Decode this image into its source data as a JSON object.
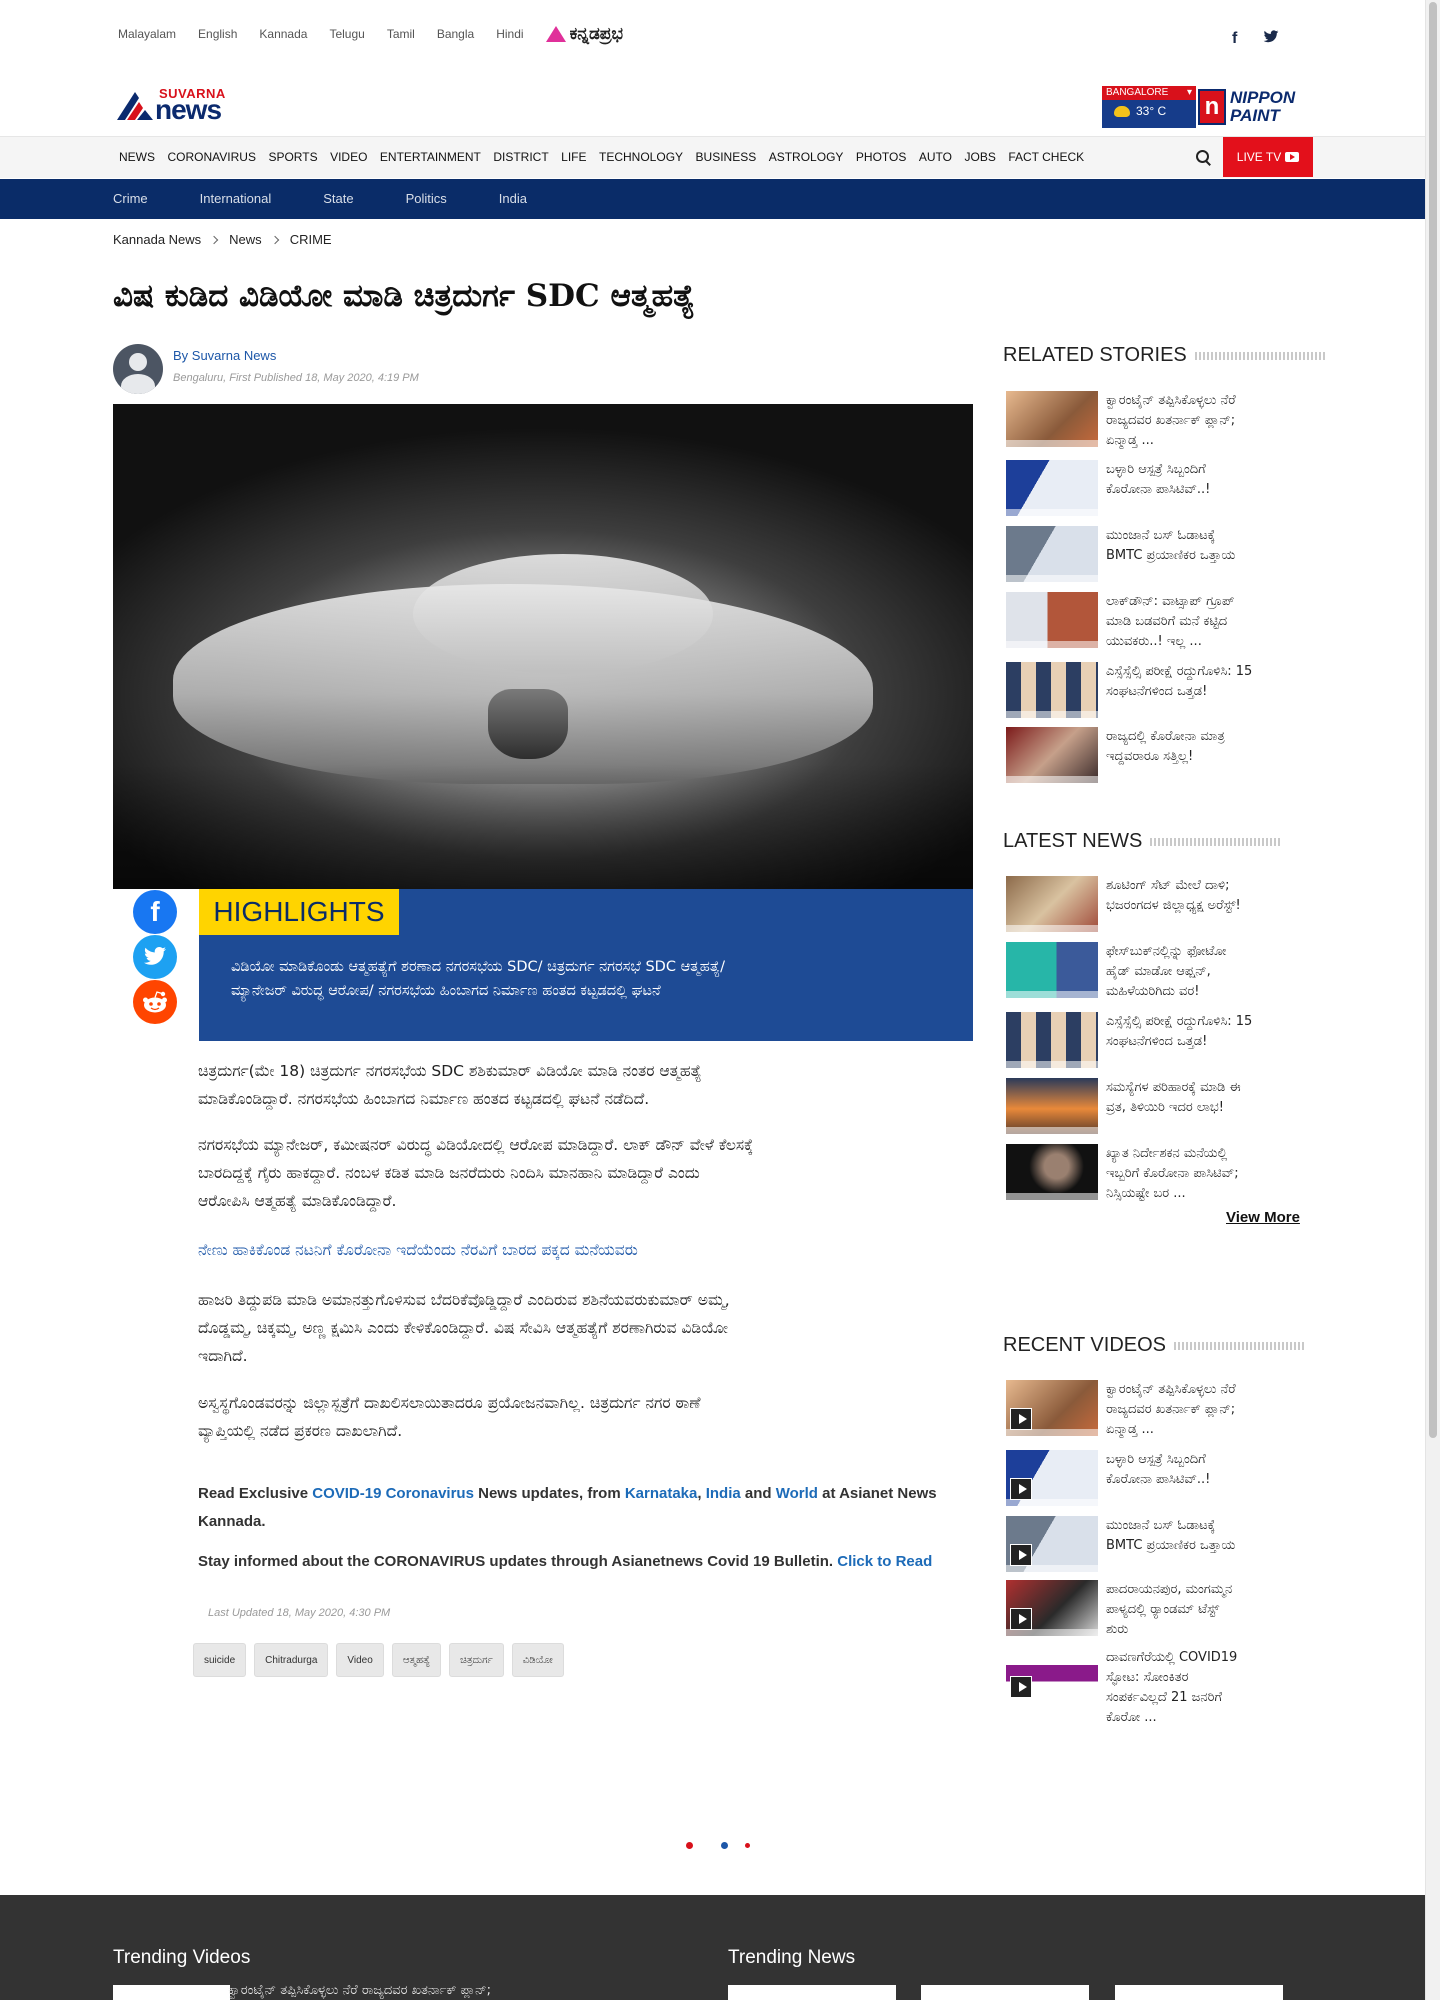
{
  "languages": [
    "Malayalam",
    "English",
    "Kannada",
    "Telugu",
    "Tamil",
    "Bangla",
    "Hindi"
  ],
  "kannadaprabha_logo": "ಕನ್ನಡಪ್ರಭ",
  "social_top": {
    "facebook": "f",
    "twitter": "t"
  },
  "logo": {
    "suvarna": "SUVARNA",
    "news": "news"
  },
  "weather": {
    "city": "BANGALORE",
    "temp": "33° C"
  },
  "sponsor": {
    "mark": "n",
    "line1": "NIPPON",
    "line2": "PAINT"
  },
  "main_nav": [
    "NEWS",
    "CORONAVIRUS",
    "SPORTS",
    "VIDEO",
    "ENTERTAINMENT",
    "DISTRICT",
    "LIFE",
    "TECHNOLOGY",
    "BUSINESS",
    "ASTROLOGY",
    "PHOTOS",
    "AUTO",
    "JOBS",
    "FACT CHECK"
  ],
  "live_tv": "LIVE TV",
  "sub_nav": [
    "Crime",
    "International",
    "State",
    "Politics",
    "India"
  ],
  "breadcrumb": [
    "Kannada News",
    "News",
    "CRIME"
  ],
  "article": {
    "title": "ವಿಷ ಕುಡಿದ ವಿಡಿಯೋ ಮಾಡಿ ಚಿತ್ರದುರ್ಗ SDC ಆತ್ಮಹತ್ಯೆ",
    "author": "By Suvarna News",
    "meta": "Bengaluru, First Published 18, May 2020, 4:19 PM",
    "highlights_label": "HIGHLIGHTS",
    "highlights_line1": "ವಿಡಿಯೋ ಮಾಡಿಕೊಂಡು ಆತ್ಮಹತ್ಯೆಗೆ ಶರಣಾದ ನಗರಸಭೆಯ SDC/ ಚಿತ್ರದುರ್ಗ ನಗರಸಭೆ SDC ಆತ್ಮಹತ್ಯೆ/",
    "highlights_line2": "ಮ್ಯಾನೇಜರ್ ವಿರುದ್ಧ ಆರೋಪ/  ನಗರಸಭೆಯ ಹಿಂಬಾಗದ ನಿರ್ಮಾಣ ಹಂತದ ಕಟ್ಟಡದಲ್ಲಿ ಘಟನೆ",
    "p1_l1": "ಚಿತ್ರದುರ್ಗ(ಮೇ 18)  ಚಿತ್ರದುರ್ಗ ನಗರಸಭೆಯ SDC ಶಶಿಕುಮಾರ್ ವಿಡಿಯೋ ಮಾಡಿ ನಂತರ ಆತ್ಮಹತ್ಯೆ",
    "p1_l2": "ಮಾಡಿಕೊಂಡಿದ್ದಾರೆ.  ನಗರಸಭೆಯ ಹಿಂಬಾಗದ ನಿರ್ಮಾಣ ಹಂತದ ಕಟ್ಟಡದಲ್ಲಿ ಘಟನೆ ನಡೆದಿದೆ.",
    "p2_l1": "ನಗರಸಭೆಯ ಮ್ಯಾನೇಜರ್, ಕಮೀಷನರ್ ವಿರುದ್ಧ ವಿಡಿಯೋದಲ್ಲಿ ಆರೋಪ ಮಾಡಿದ್ದಾರೆ. ಲಾಕ್ ಡೌನ್ ವೇಳೆ ಕೆಲಸಕ್ಕೆ",
    "p2_l2": " ಬಾರದಿದ್ದಕ್ಕೆ ಗೈರು ಹಾಕದ್ದಾರೆ.  ನಂಬಳ ಕಡಿತ ಮಾಡಿ  ಜನರೆದುರು ನಿಂದಿಸಿ ಮಾನಹಾನಿ ಮಾಡಿದ್ದಾರೆ ಎಂದು",
    "p2_l3": "ಆರೋಪಿಸಿ ಆತ್ಮಹತ್ಯೆ ಮಾಡಿಕೊಂಡಿದ್ದಾರೆ.",
    "related_link": "ನೇಣು ಹಾಕಿಕೊಂಡ ನಟನಿಗೆ ಕೊರೋನಾ ಇದೆಯೆಂದು ನೆರವಿಗೆ ಬಾರದ ಪಕ್ಕದ ಮನೆಯವರು",
    "p3_l1": "ಹಾಜರಿ ತಿದ್ದುಪಡಿ ಮಾಡಿ ಅಮಾನತ್ತುಗೊಳಿಸುವ ಬೆದರಿಕೆವೊಡ್ಡಿದ್ದಾರೆ ಎಂದಿರುವ ಶಶಿನೆಯವರುಕುಮಾರ್ ಅಮ್ಮ,",
    "p3_l2": "ದೊಡ್ಡಮ್ಮ, ಚಿಕ್ಕಮ್ಮ, ಅಣ್ಣ ಕ್ಷಮಿಸಿ ಎಂದು ಕೇಳಿಕೊಂಡಿದ್ದಾರೆ.  ವಿಷ ಸೇವಿಸಿ ಆತ್ಮಹತ್ಯೆಗೆ ಶರಣಾಗಿರುವ ವಿಡಿಯೋ",
    "p3_l3": "ಇದಾಗಿದೆ.",
    "p4_l1": "ಅಸ್ವಸ್ಥಗೊಂಡವರನ್ನು ಜಿಲ್ಲಾಸ್ಪತ್ರೆಗೆ ದಾಖಲಿಸಲಾಯಿತಾದರೂ ಪ್ರಯೋಜನವಾಗಿಲ್ಲ.  ಚಿತ್ರದುರ್ಗ ನಗರ ಠಾಣೆ",
    "p4_l2": "ವ್ಯಾಪ್ತಿಯಲ್ಲಿ ನಡೆದ ಪ್ರಕರಣ ದಾಖಲಾಗಿದೆ.",
    "read_pre": "Read Exclusive ",
    "read_covid": "COVID-19 Coronavirus",
    "read_mid": " News updates, from ",
    "read_karnataka": "Karnataka",
    "read_comma": ", ",
    "read_india": "India",
    "read_and": " and ",
    "read_world": "World",
    "read_post": " at Asianet News",
    "read_post2": "Kannada.",
    "stay_text": "Stay informed about the CORONAVIRUS updates through Asianetnews Covid 19 Bulletin. ",
    "click_read": "Click to Read",
    "last_updated": "Last Updated 18, May 2020, 4:30 PM",
    "tags": [
      "suicide",
      "Chitradurga",
      "Video",
      "ಆತ್ಮಹತ್ಯೆ",
      "ಚಿತ್ರದುರ್ಗ",
      "ವಿಡಿಯೋ"
    ]
  },
  "related_stories": {
    "heading": "RELATED STORIES",
    "items": [
      {
        "l1": "ಕ್ವಾರಂಟೈನ್ ತಪ್ಪಿಸಿಕೊಳ್ಳಲು ನೆರೆ",
        "l2": "ರಾಜ್ಯದವರ ಖತರ್ನಾಕ್ ಪ್ಲಾನ್;",
        "l3": "ಏನ್ಮಾಡ್ತ ..."
      },
      {
        "l1": "ಬಳ್ಳಾರಿ ಆಸ್ಪತ್ರೆ ಸಿಬ್ಬಂದಿಗೆ",
        "l2": "ಕೊರೋನಾ ಪಾಸಿಟಿವ್..!",
        "l3": ""
      },
      {
        "l1": "ಮುಂಜಾನೆ ಬಸ್ ಓಡಾಟಕ್ಕೆ",
        "l2": "BMTC ಪ್ರಯಾಣಿಕರ ಒತ್ತಾಯ",
        "l3": ""
      },
      {
        "l1": "ಲಾಕ್‌ಡೌನ್: ವಾಟ್ಸಾಪ್ ಗ್ರೂಪ್",
        "l2": "ಮಾಡಿ ಬಡವರಿಗೆ ಮನೆ ಕಟ್ಟಿದ",
        "l3": "ಯುವಕರು..! ಇಲ್ಲ ..."
      },
      {
        "l1": "ಎಸ್ಸೆಸ್ಸೆಲ್ಸಿ ಪರೀಕ್ಷೆ ರದ್ದುಗೊಳಿಸಿ: 15",
        "l2": "ಸಂಘಟನೆಗಳಿಂದ ಒತ್ತಡ!",
        "l3": ""
      },
      {
        "l1": "ರಾಜ್ಯದಲ್ಲಿ ಕೊರೋನಾ ಮಾತ್ರ",
        "l2": "ಇದ್ದವರಾರೂ ಸತ್ತಿಲ್ಲ!",
        "l3": ""
      }
    ]
  },
  "latest_news": {
    "heading": "LATEST NEWS",
    "items": [
      {
        "l1": "ಶೂಟಿಂಗ್ ಸೆಟ್ ಮೇಲೆ ದಾಳಿ;",
        "l2": "ಭಜರಂಗದಳ ಜಿಲ್ಲಾಧ್ಯಕ್ಷ ಅರೆಸ್ಟ್!",
        "l3": ""
      },
      {
        "l1": "ಫೇಸ್‌ಬುಕ್‌ನಲ್ಲಿನ್ನು ಫೋಟೋ",
        "l2": "ಹೈಡ್ ಮಾಡೋ ಆಪ್ಷನ್,",
        "l3": "ಮಹಿಳೆಯರಿಗಿದು ವರ!"
      },
      {
        "l1": "ಎಸ್ಸೆಸ್ಸೆಲ್ಸಿ ಪರೀಕ್ಷೆ ರದ್ದುಗೊಳಿಸಿ: 15",
        "l2": "ಸಂಘಟನೆಗಳಿಂದ ಒತ್ತಡ!",
        "l3": ""
      },
      {
        "l1": "ಸಮಸ್ಯೆಗಳ ಪರಿಹಾರಕ್ಕೆ ಮಾಡಿ ಈ",
        "l2": "ವ್ರತ, ತಿಳಿಯಿರಿ ಇದರ ಲಾಭ!",
        "l3": ""
      },
      {
        "l1": "ಖ್ಯಾತ ನಿರ್ದೇಶಕನ ಮನೆಯಲ್ಲಿ",
        "l2": "ಇಬ್ಬರಿಗೆ ಕೊರೋನಾ ಪಾಸಿಟಿವ್;",
        "l3": "ನಿಸ್ಸಿಯಷ್ಟೇ ಬರ ..."
      }
    ],
    "view_more": "View More"
  },
  "recent_videos": {
    "heading": "RECENT VIDEOS",
    "items": [
      {
        "l1": "ಕ್ವಾರಂಟೈನ್ ತಪ್ಪಿಸಿಕೊಳ್ಳಲು ನೆರೆ",
        "l2": "ರಾಜ್ಯದವರ ಖತರ್ನಾಕ್ ಪ್ಲಾನ್;",
        "l3": "ಏನ್ಮಾಡ್ತ ...",
        "l4": ""
      },
      {
        "l1": "ಬಳ್ಳಾರಿ ಆಸ್ಪತ್ರೆ ಸಿಬ್ಬಂದಿಗೆ",
        "l2": "ಕೊರೋನಾ ಪಾಸಿಟಿವ್..!",
        "l3": "",
        "l4": ""
      },
      {
        "l1": "ಮುಂಜಾನೆ ಬಸ್ ಓಡಾಟಕ್ಕೆ",
        "l2": "BMTC ಪ್ರಯಾಣಿಕರ ಒತ್ತಾಯ",
        "l3": "",
        "l4": ""
      },
      {
        "l1": "ಪಾದರಾಯನಪುರ, ಮಂಗಮ್ಮನ",
        "l2": "ಪಾಳ್ಯದಲ್ಲಿ ರ್‍ಯಾಂಡಮ್ ಟೆಸ್ಟ್",
        "l3": "ಶುರು",
        "l4": ""
      },
      {
        "l1": "ದಾವಣಗೆರೆಯಲ್ಲಿ COVID19",
        "l2": "ಸ್ಫೋಟ: ಸೋಂಕಿತರ",
        "l3": "ಸಂಪರ್ಕವಿಲ್ಲದೆ 21 ಜನರಿಗೆ",
        "l4": "ಕೊರೋ ..."
      }
    ]
  },
  "footer": {
    "trending_videos": "Trending Videos",
    "trending_news": "Trending News",
    "first_video": "ಕ್ವಾರಂಟೈನ್ ತಪ್ಪಿಸಿಕೊಳ್ಳಲು ನೆರೆ ರಾಜ್ಯದವರ ಖತರ್ನಾಕ್ ಪ್ಲಾನ್;"
  },
  "colors": {
    "brand_red": "#e3101b",
    "brand_navy": "#0a2c68",
    "highlight_blue": "#1e4b95",
    "highlight_yellow": "#ffd400",
    "link_blue": "#1d57a8"
  }
}
